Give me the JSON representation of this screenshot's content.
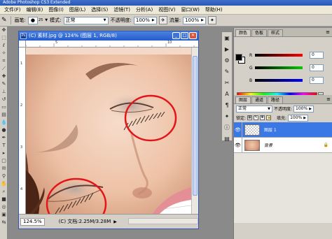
{
  "app": {
    "title": "Adobe Photoshop CS3 Extended"
  },
  "menu": [
    "文件(F)",
    "编辑(E)",
    "图像(I)",
    "图层(L)",
    "选择(S)",
    "滤镜(T)",
    "分析(A)",
    "视图(V)",
    "窗口(W)",
    "帮助(H)"
  ],
  "options": {
    "brush_label": "画笔:",
    "brush_size": "25",
    "mode_label": "模式:",
    "mode_value": "正常",
    "opacity_label": "不透明度:",
    "opacity_value": "100%",
    "flow_label": "流量:",
    "flow_value": "100%"
  },
  "document": {
    "title": "(C) 素材.jpg @ 124% (图层 1, RGB/8)",
    "ruler_top": [
      "5",
      "10"
    ],
    "ruler_left": [
      "1",
      "2",
      "3",
      "4"
    ],
    "zoom": "124.5%",
    "doc_info": "(C) 文档:2.25M/3.28M"
  },
  "color_panel": {
    "tabs": [
      "颜色",
      "色板",
      "样式"
    ],
    "sliders": [
      {
        "label": "R",
        "value": "0",
        "color": "#e00000"
      },
      {
        "label": "G",
        "value": "0",
        "color": "#00b000"
      },
      {
        "label": "B",
        "value": "0",
        "color": "#0000e0"
      }
    ]
  },
  "layers_panel": {
    "tabs": [
      "图层",
      "通道",
      "路径"
    ],
    "blend_mode": "正常",
    "opacity_label": "不透明度:",
    "opacity_value": "100%",
    "lock_label": "锁定:",
    "fill_label": "填充:",
    "fill_value": "100%",
    "layers": [
      {
        "name": "图层 1",
        "selected": true
      },
      {
        "name": "背景",
        "selected": false
      }
    ]
  }
}
